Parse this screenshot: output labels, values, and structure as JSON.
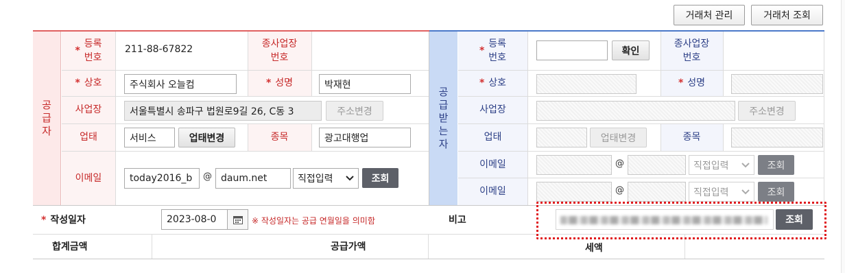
{
  "top": {
    "partner_manage": "거래처 관리",
    "partner_search": "거래처 조회"
  },
  "supplier": {
    "section_label": "공급자",
    "reg_no_label": "등록\n번호",
    "reg_no": "211-88-67822",
    "sub_biz_label": "종사업장\n번호",
    "company_label": "상호",
    "company": "주식회사 오늘컴",
    "name_label": "성명",
    "name": "박재현",
    "address_label": "사업장",
    "address": "서울특별시 송파구 법원로9길 26, C동 3",
    "address_btn": "주소변경",
    "biz_type_label": "업태",
    "biz_type": "서비스",
    "biz_type_btn": "업태변경",
    "item_label": "종목",
    "item": "광고대행업",
    "email_label": "이메일",
    "email_id": "today2016_b",
    "email_at": "@",
    "email_domain": "daum.net",
    "email_select": "직접입력",
    "email_btn": "조회"
  },
  "receiver": {
    "section_label": "공급받는자",
    "reg_no_label": "등록\n번호",
    "confirm_btn": "확인",
    "sub_biz_label": "종사업장\n번호",
    "company_label": "상호",
    "name_label": "성명",
    "address_label": "사업장",
    "address_btn": "주소변경",
    "biz_type_label": "업태",
    "biz_type_btn": "업태변경",
    "item_label": "종목",
    "email1_label": "이메일",
    "email1_at": "@",
    "email1_select": "직접입력",
    "email1_btn": "조회",
    "email2_label": "이메일",
    "email2_at": "@",
    "email2_select": "직접입력",
    "email2_btn": "조회"
  },
  "footer": {
    "date_label": "작성일자",
    "date_value": "2023-08-0",
    "date_note": "※ 작성일자는 공급 연월일을 의미함",
    "remark_label": "비고",
    "remark_btn": "조회",
    "total_label": "합계금액",
    "supply_label": "공급가액",
    "tax_label": "세액"
  },
  "colors": {
    "supplier_accent": "#e06060",
    "receiver_accent": "#4a78c9",
    "highlight_border": "#e0181c"
  }
}
